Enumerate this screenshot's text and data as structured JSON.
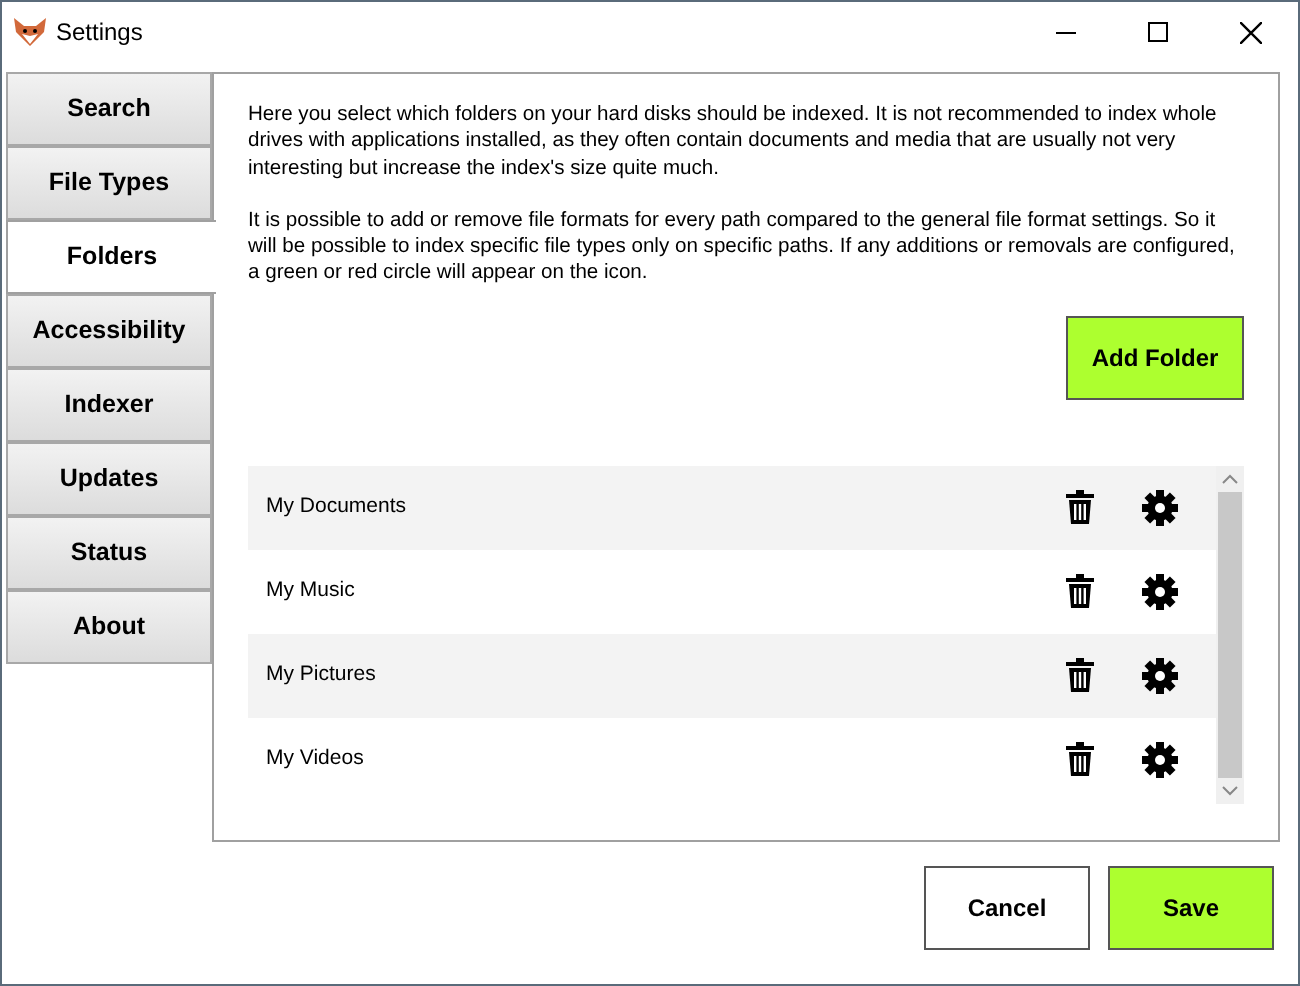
{
  "window": {
    "title": "Settings"
  },
  "tabs": [
    {
      "label": "Search",
      "selected": false
    },
    {
      "label": "File Types",
      "selected": false
    },
    {
      "label": "Folders",
      "selected": true
    },
    {
      "label": "Accessibility",
      "selected": false
    },
    {
      "label": "Indexer",
      "selected": false
    },
    {
      "label": "Updates",
      "selected": false
    },
    {
      "label": "Status",
      "selected": false
    },
    {
      "label": "About",
      "selected": false
    }
  ],
  "description": [
    "Here you select which folders on your hard disks should be indexed. It is not recommended to index whole drives with applications installed, as they often contain documents and media that are usually not very interesting but increase the index's size quite much.",
    "It is possible to add or remove file formats for every path compared to the general file format settings. So it will be possible to index specific file types only on specific paths. If any additions or removals are configured, a green or red circle will appear on the icon."
  ],
  "add_button": "Add Folder",
  "folders": [
    {
      "name": "My Documents"
    },
    {
      "name": "My Music"
    },
    {
      "name": "My Pictures"
    },
    {
      "name": "My Videos"
    }
  ],
  "buttons": {
    "cancel": "Cancel",
    "save": "Save"
  }
}
